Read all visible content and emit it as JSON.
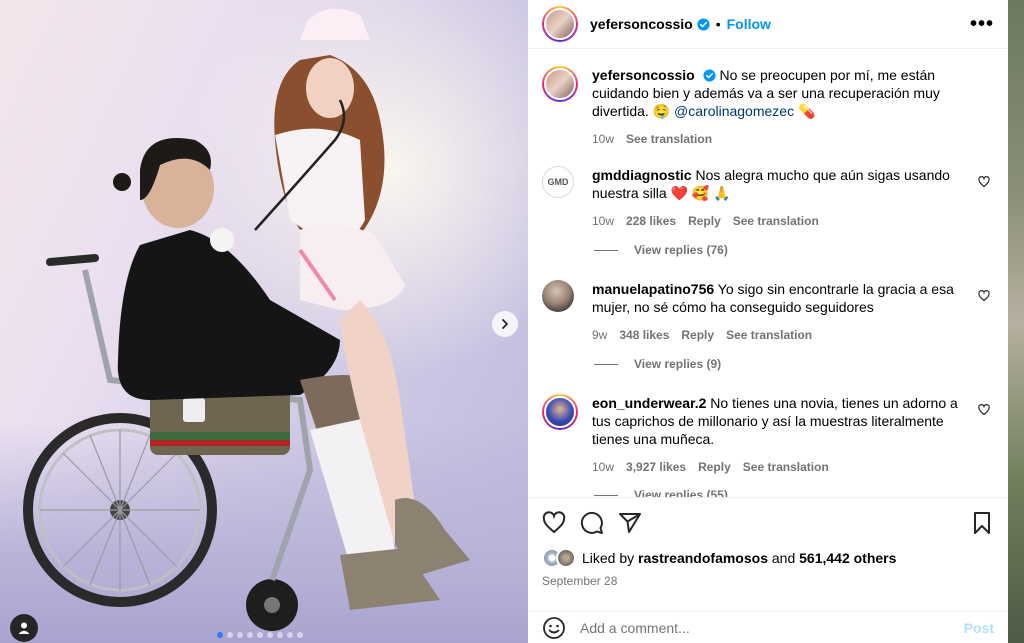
{
  "post": {
    "username": "yefersoncossio",
    "follow_label": "Follow",
    "separator": "•",
    "more_label": "•••",
    "caption": {
      "username": "yefersoncossio",
      "text": "No se preocupen por mí, me están cuidando bien y además va a ser una recuperación muy divertida. 🤤",
      "mention": "@carolinagomezec",
      "emoji": "💊",
      "time": "10w",
      "translate": "See translation"
    },
    "comments": [
      {
        "username": "gmddiagnostic",
        "text": "Nos alegra mucho que aún sigas usando nuestra silla ❤️ 🥰 🙏",
        "time": "10w",
        "likes": "228 likes",
        "reply": "Reply",
        "translate": "See translation",
        "view_replies": "View replies (76)",
        "avatar_text": "GMD"
      },
      {
        "username": "manuelapatino756",
        "text": "Yo sigo sin encontrarle la gracia a esa mujer, no sé cómo ha conseguido seguidores",
        "time": "9w",
        "likes": "348 likes",
        "reply": "Reply",
        "translate": "See translation",
        "view_replies": "View replies (9)"
      },
      {
        "username": "eon_underwear.2",
        "text": "No tienes una novia, tienes un adorno a tus caprichos de millonario y así la muestras literalmente tienes una muñeca.",
        "time": "10w",
        "likes": "3,927 likes",
        "reply": "Reply",
        "translate": "See translation",
        "view_replies": "View replies (55)"
      }
    ],
    "likes": {
      "prefix": "Liked by",
      "user": "rastreandofamosos",
      "conj": "and",
      "count": "561,442 others"
    },
    "date": "September 28",
    "add_comment": {
      "placeholder": "Add a comment...",
      "post_label": "Post"
    }
  },
  "carousel": {
    "dots_total": 9,
    "active_index": 0
  },
  "colors": {
    "accent": "#0095f6",
    "heart": "#ed4956",
    "muted": "#737373"
  },
  "icons": [
    "verified-icon",
    "more-icon",
    "heart-icon",
    "comment-icon",
    "share-icon",
    "save-icon",
    "emoji-icon",
    "chevron-right-icon",
    "user-tag-icon"
  ]
}
